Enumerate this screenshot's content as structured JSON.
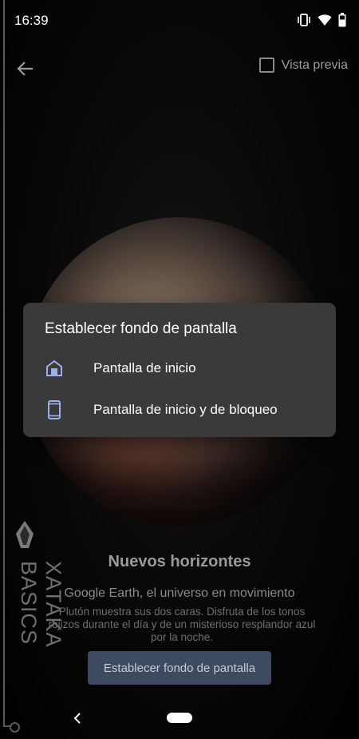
{
  "status_bar": {
    "time": "16:39",
    "icons": [
      "vibrate-icon",
      "wifi-icon",
      "battery-icon"
    ]
  },
  "top_bar": {
    "back_icon": "arrow-left-icon",
    "preview_label": "Vista previa",
    "preview_checked": false
  },
  "dialog": {
    "title": "Establecer fondo de pantalla",
    "options": [
      {
        "icon": "home-icon",
        "label": "Pantalla de inicio"
      },
      {
        "icon": "phone-icon",
        "label": "Pantalla de inicio y de bloqueo"
      }
    ],
    "icon_color": "#9bb0e8"
  },
  "wallpaper": {
    "title": "Nuevos horizontes",
    "subtitle": "Google Earth, el universo en movimiento",
    "description": "Plutón muestra sus dos caras. Disfruta de los tonos rojizos durante el día y de un misterioso resplandor azul por la noche."
  },
  "set_button_label": "Establecer fondo de pantalla",
  "watermark": {
    "text": "XATAKA BASICS"
  },
  "nav_bar": {
    "back_icon": "nav-back-icon",
    "home_icon": "nav-home-pill"
  }
}
